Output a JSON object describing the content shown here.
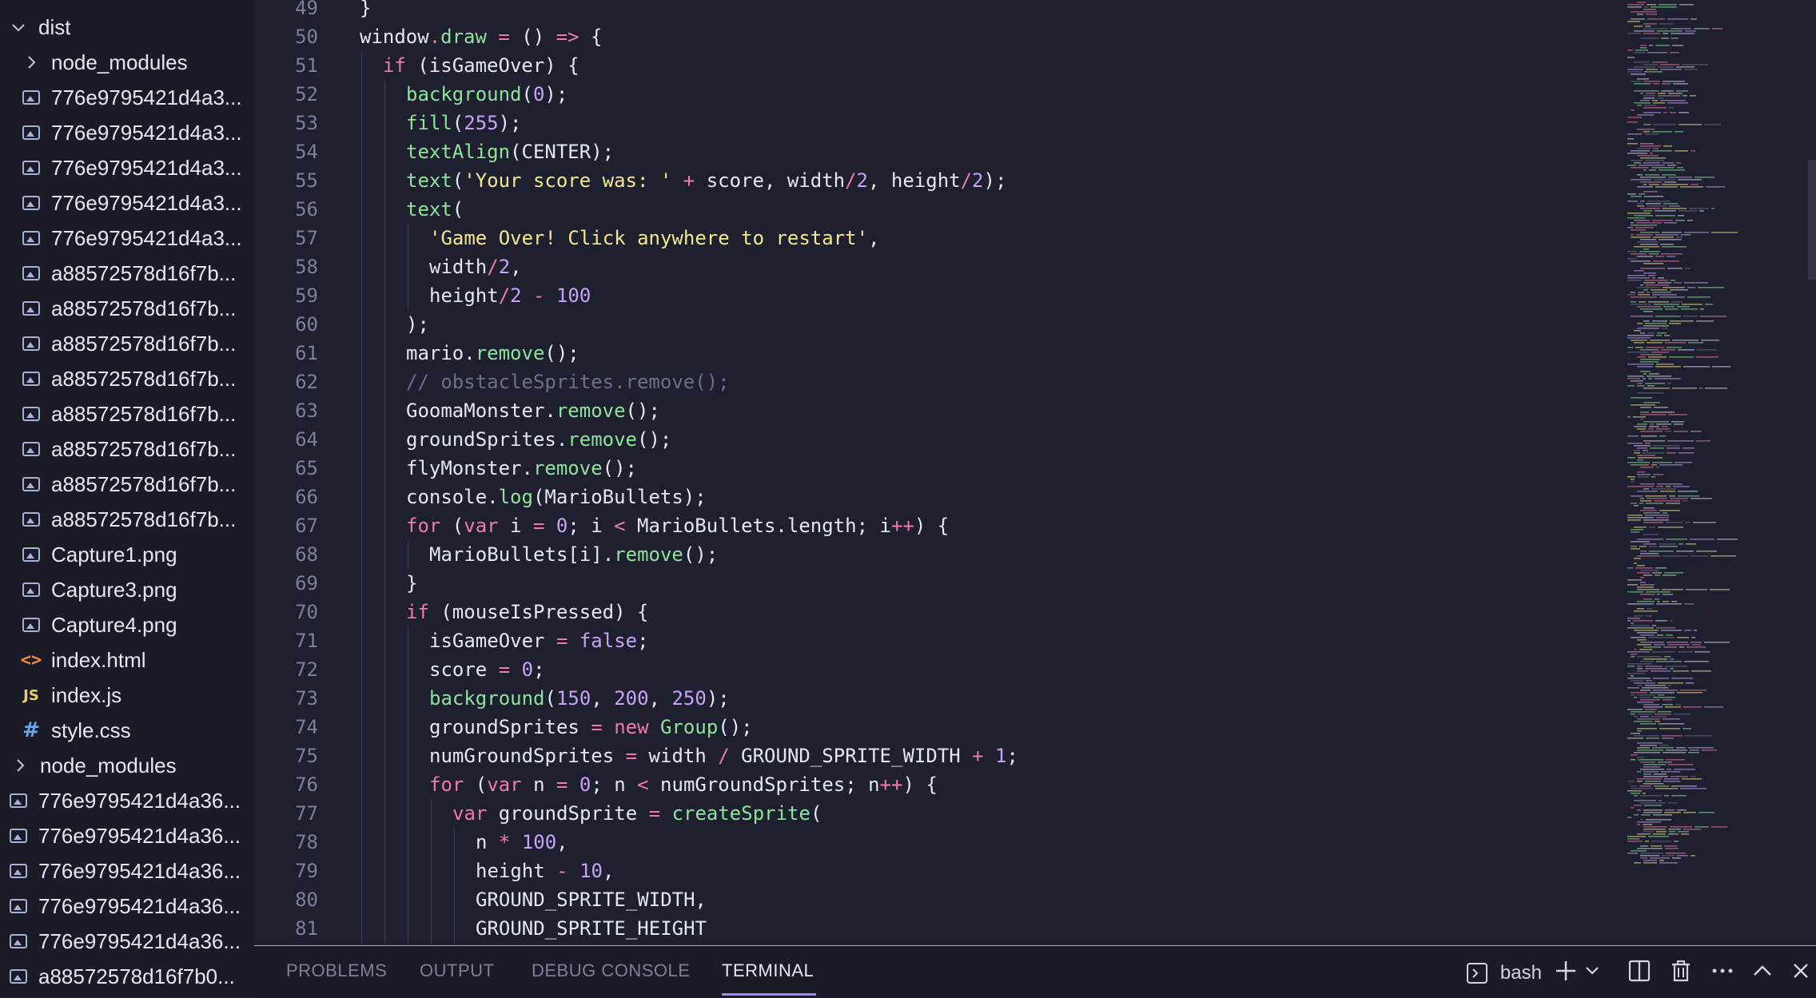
{
  "sidebar": {
    "items": [
      {
        "label": "dist",
        "icon": "chevron-down-icon",
        "indent": 0
      },
      {
        "label": "node_modules",
        "icon": "chevron-right-icon",
        "indent": 1
      },
      {
        "label": "776e9795421d4a3...",
        "icon": "image-icon",
        "indent": 1
      },
      {
        "label": "776e9795421d4a3...",
        "icon": "image-icon",
        "indent": 1
      },
      {
        "label": "776e9795421d4a3...",
        "icon": "image-icon",
        "indent": 1
      },
      {
        "label": "776e9795421d4a3...",
        "icon": "image-icon",
        "indent": 1
      },
      {
        "label": "776e9795421d4a3...",
        "icon": "image-icon",
        "indent": 1
      },
      {
        "label": "a88572578d16f7b...",
        "icon": "image-icon",
        "indent": 1
      },
      {
        "label": "a88572578d16f7b...",
        "icon": "image-icon",
        "indent": 1
      },
      {
        "label": "a88572578d16f7b...",
        "icon": "image-icon",
        "indent": 1
      },
      {
        "label": "a88572578d16f7b...",
        "icon": "image-icon",
        "indent": 1
      },
      {
        "label": "a88572578d16f7b...",
        "icon": "image-icon",
        "indent": 1
      },
      {
        "label": "a88572578d16f7b...",
        "icon": "image-icon",
        "indent": 1
      },
      {
        "label": "a88572578d16f7b...",
        "icon": "image-icon",
        "indent": 1
      },
      {
        "label": "a88572578d16f7b...",
        "icon": "image-icon",
        "indent": 1
      },
      {
        "label": "Capture1.png",
        "icon": "image-icon",
        "indent": 1
      },
      {
        "label": "Capture3.png",
        "icon": "image-icon",
        "indent": 1
      },
      {
        "label": "Capture4.png",
        "icon": "image-icon",
        "indent": 1
      },
      {
        "label": "index.html",
        "icon": "html-file-icon",
        "indent": 1
      },
      {
        "label": "index.js",
        "icon": "js-file-icon",
        "indent": 1
      },
      {
        "label": "style.css",
        "icon": "css-file-icon",
        "indent": 1
      },
      {
        "label": "node_modules",
        "icon": "chevron-right-icon",
        "indent": 0
      },
      {
        "label": "776e9795421d4a36...",
        "icon": "image-icon",
        "indent": 0
      },
      {
        "label": "776e9795421d4a36...",
        "icon": "image-icon",
        "indent": 0
      },
      {
        "label": "776e9795421d4a36...",
        "icon": "image-icon",
        "indent": 0
      },
      {
        "label": "776e9795421d4a36...",
        "icon": "image-icon",
        "indent": 0
      },
      {
        "label": "776e9795421d4a36...",
        "icon": "image-icon",
        "indent": 0
      },
      {
        "label": "a88572578d16f7b0...",
        "icon": "image-icon",
        "indent": 0
      }
    ]
  },
  "editor": {
    "lines": [
      {
        "n": "49",
        "indent": 0,
        "tokens": [
          [
            "pl",
            "}"
          ]
        ]
      },
      {
        "n": "50",
        "indent": 0,
        "tokens": [
          [
            "pl",
            "window"
          ],
          [
            "op",
            "."
          ],
          [
            "fn",
            "draw"
          ],
          [
            "pl",
            " "
          ],
          [
            "op",
            "="
          ],
          [
            "pl",
            " () "
          ],
          [
            "op",
            "=>"
          ],
          [
            "pl",
            " {"
          ]
        ]
      },
      {
        "n": "51",
        "indent": 1,
        "tokens": [
          [
            "kw",
            "if"
          ],
          [
            "pl",
            " (isGameOver) {"
          ]
        ]
      },
      {
        "n": "52",
        "indent": 2,
        "tokens": [
          [
            "fn",
            "background"
          ],
          [
            "pl",
            "("
          ],
          [
            "num",
            "0"
          ],
          [
            "pl",
            ");"
          ]
        ]
      },
      {
        "n": "53",
        "indent": 2,
        "tokens": [
          [
            "fn",
            "fill"
          ],
          [
            "pl",
            "("
          ],
          [
            "num",
            "255"
          ],
          [
            "pl",
            ");"
          ]
        ]
      },
      {
        "n": "54",
        "indent": 2,
        "tokens": [
          [
            "fn",
            "textAlign"
          ],
          [
            "pl",
            "(CENTER);"
          ]
        ]
      },
      {
        "n": "55",
        "indent": 2,
        "tokens": [
          [
            "fn",
            "text"
          ],
          [
            "pl",
            "("
          ],
          [
            "str",
            "'Your score was: '"
          ],
          [
            "pl",
            " "
          ],
          [
            "op",
            "+"
          ],
          [
            "pl",
            " score, width"
          ],
          [
            "op",
            "/"
          ],
          [
            "num",
            "2"
          ],
          [
            "pl",
            ", height"
          ],
          [
            "op",
            "/"
          ],
          [
            "num",
            "2"
          ],
          [
            "pl",
            ");"
          ]
        ]
      },
      {
        "n": "56",
        "indent": 2,
        "tokens": [
          [
            "fn",
            "text"
          ],
          [
            "pl",
            "("
          ]
        ]
      },
      {
        "n": "57",
        "indent": 3,
        "tokens": [
          [
            "str",
            "'Game Over! Click anywhere to restart'"
          ],
          [
            "pl",
            ","
          ]
        ]
      },
      {
        "n": "58",
        "indent": 3,
        "tokens": [
          [
            "pl",
            "width"
          ],
          [
            "op",
            "/"
          ],
          [
            "num",
            "2"
          ],
          [
            "pl",
            ","
          ]
        ]
      },
      {
        "n": "59",
        "indent": 3,
        "tokens": [
          [
            "pl",
            "height"
          ],
          [
            "op",
            "/"
          ],
          [
            "num",
            "2"
          ],
          [
            "pl",
            " "
          ],
          [
            "op",
            "-"
          ],
          [
            "pl",
            " "
          ],
          [
            "num",
            "100"
          ]
        ]
      },
      {
        "n": "60",
        "indent": 2,
        "tokens": [
          [
            "pl",
            ");"
          ]
        ]
      },
      {
        "n": "61",
        "indent": 2,
        "tokens": [
          [
            "pl",
            "mario."
          ],
          [
            "fn",
            "remove"
          ],
          [
            "pl",
            "();"
          ]
        ]
      },
      {
        "n": "62",
        "indent": 2,
        "tokens": [
          [
            "cm",
            "// obstacleSprites.remove();"
          ]
        ]
      },
      {
        "n": "63",
        "indent": 2,
        "tokens": [
          [
            "pl",
            "GoomaMonster."
          ],
          [
            "fn",
            "remove"
          ],
          [
            "pl",
            "();"
          ]
        ]
      },
      {
        "n": "64",
        "indent": 2,
        "tokens": [
          [
            "pl",
            "groundSprites."
          ],
          [
            "fn",
            "remove"
          ],
          [
            "pl",
            "();"
          ]
        ]
      },
      {
        "n": "65",
        "indent": 2,
        "tokens": [
          [
            "pl",
            "flyMonster."
          ],
          [
            "fn",
            "remove"
          ],
          [
            "pl",
            "();"
          ]
        ]
      },
      {
        "n": "66",
        "indent": 2,
        "tokens": [
          [
            "pl",
            "console."
          ],
          [
            "fn",
            "log"
          ],
          [
            "pl",
            "(MarioBullets);"
          ]
        ]
      },
      {
        "n": "67",
        "indent": 2,
        "tokens": [
          [
            "kw",
            "for"
          ],
          [
            "pl",
            " ("
          ],
          [
            "kw",
            "var"
          ],
          [
            "pl",
            " i "
          ],
          [
            "op",
            "="
          ],
          [
            "pl",
            " "
          ],
          [
            "num",
            "0"
          ],
          [
            "pl",
            "; i "
          ],
          [
            "op",
            "<"
          ],
          [
            "pl",
            " MarioBullets.length; i"
          ],
          [
            "op",
            "++"
          ],
          [
            "pl",
            ") {"
          ]
        ]
      },
      {
        "n": "68",
        "indent": 3,
        "tokens": [
          [
            "pl",
            "MarioBullets[i]."
          ],
          [
            "fn",
            "remove"
          ],
          [
            "pl",
            "();"
          ]
        ]
      },
      {
        "n": "69",
        "indent": 2,
        "tokens": [
          [
            "pl",
            "}"
          ]
        ]
      },
      {
        "n": "70",
        "indent": 2,
        "tokens": [
          [
            "kw",
            "if"
          ],
          [
            "pl",
            " (mouseIsPressed) {"
          ]
        ]
      },
      {
        "n": "71",
        "indent": 3,
        "tokens": [
          [
            "pl",
            "isGameOver "
          ],
          [
            "op",
            "="
          ],
          [
            "pl",
            " "
          ],
          [
            "num",
            "false"
          ],
          [
            "pl",
            ";"
          ]
        ]
      },
      {
        "n": "72",
        "indent": 3,
        "tokens": [
          [
            "pl",
            "score "
          ],
          [
            "op",
            "="
          ],
          [
            "pl",
            " "
          ],
          [
            "num",
            "0"
          ],
          [
            "pl",
            ";"
          ]
        ]
      },
      {
        "n": "73",
        "indent": 3,
        "tokens": [
          [
            "fn",
            "background"
          ],
          [
            "pl",
            "("
          ],
          [
            "num",
            "150"
          ],
          [
            "pl",
            ", "
          ],
          [
            "num",
            "200"
          ],
          [
            "pl",
            ", "
          ],
          [
            "num",
            "250"
          ],
          [
            "pl",
            ");"
          ]
        ]
      },
      {
        "n": "74",
        "indent": 3,
        "tokens": [
          [
            "pl",
            "groundSprites "
          ],
          [
            "op",
            "="
          ],
          [
            "pl",
            " "
          ],
          [
            "kw",
            "new"
          ],
          [
            "pl",
            " "
          ],
          [
            "fn",
            "Group"
          ],
          [
            "pl",
            "();"
          ]
        ]
      },
      {
        "n": "75",
        "indent": 3,
        "tokens": [
          [
            "pl",
            "numGroundSprites "
          ],
          [
            "op",
            "="
          ],
          [
            "pl",
            " width "
          ],
          [
            "op",
            "/"
          ],
          [
            "pl",
            " GROUND_SPRITE_WIDTH "
          ],
          [
            "op",
            "+"
          ],
          [
            "pl",
            " "
          ],
          [
            "num",
            "1"
          ],
          [
            "pl",
            ";"
          ]
        ]
      },
      {
        "n": "76",
        "indent": 3,
        "tokens": [
          [
            "kw",
            "for"
          ],
          [
            "pl",
            " ("
          ],
          [
            "kw",
            "var"
          ],
          [
            "pl",
            " n "
          ],
          [
            "op",
            "="
          ],
          [
            "pl",
            " "
          ],
          [
            "num",
            "0"
          ],
          [
            "pl",
            "; n "
          ],
          [
            "op",
            "<"
          ],
          [
            "pl",
            " numGroundSprites; n"
          ],
          [
            "op",
            "++"
          ],
          [
            "pl",
            ") {"
          ]
        ]
      },
      {
        "n": "77",
        "indent": 4,
        "tokens": [
          [
            "kw",
            "var"
          ],
          [
            "pl",
            " groundSprite "
          ],
          [
            "op",
            "="
          ],
          [
            "pl",
            " "
          ],
          [
            "fn",
            "createSprite"
          ],
          [
            "pl",
            "("
          ]
        ]
      },
      {
        "n": "78",
        "indent": 5,
        "tokens": [
          [
            "pl",
            "n "
          ],
          [
            "op",
            "*"
          ],
          [
            "pl",
            " "
          ],
          [
            "num",
            "100"
          ],
          [
            "pl",
            ","
          ]
        ]
      },
      {
        "n": "79",
        "indent": 5,
        "tokens": [
          [
            "pl",
            "height "
          ],
          [
            "op",
            "-"
          ],
          [
            "pl",
            " "
          ],
          [
            "num",
            "10"
          ],
          [
            "pl",
            ","
          ]
        ]
      },
      {
        "n": "80",
        "indent": 5,
        "tokens": [
          [
            "pl",
            "GROUND_SPRITE_WIDTH,"
          ]
        ]
      },
      {
        "n": "81",
        "indent": 5,
        "tokens": [
          [
            "pl",
            "GROUND_SPRITE_HEIGHT"
          ]
        ]
      }
    ]
  },
  "panel": {
    "tabs": [
      "PROBLEMS",
      "OUTPUT",
      "DEBUG CONSOLE",
      "TERMINAL"
    ],
    "active_tab": "TERMINAL",
    "terminal_name": "bash"
  },
  "colors": {
    "accent": "#a882ff",
    "keyword": "#f07aa8",
    "function": "#8ee39a",
    "number": "#c9a2f5",
    "string": "#f2e78f"
  }
}
